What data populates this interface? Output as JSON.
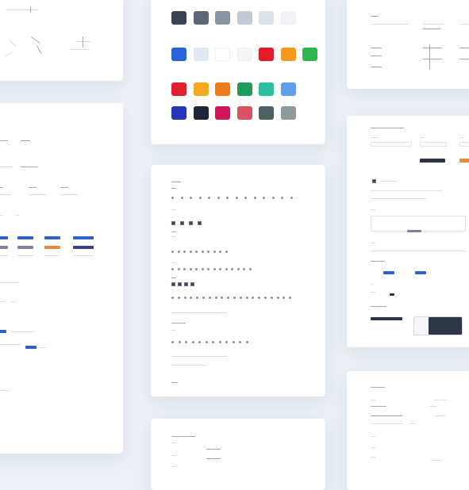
{
  "colors": {
    "background": "#edf1f7",
    "card": "#ffffff",
    "primary": "#2f62c7",
    "swatch_rows": [
      [
        "#3b4252",
        "#5d6677",
        "#8a93a4",
        "#c4cad5",
        "#dde1e8",
        "#f1f3f6"
      ],
      [
        "#2b63d9",
        "#dfe9f8",
        "#ffffff",
        "#f4f5f7",
        "#e21b2c",
        "#f39a1c",
        "#2fb550"
      ],
      [
        "#e0202e",
        "#f5a91f",
        "#ef7a1a",
        "#1f9c5c",
        "#2cbf9d",
        "#5fa0e8"
      ],
      [
        "#2636b8",
        "#1f2439",
        "#d4145a",
        "#d9525e",
        "#4c5f63",
        "#8d9b9e"
      ]
    ]
  },
  "icons": {
    "check_icon": "check-icon",
    "radio_icon": "radio-icon",
    "toggle_icon": "toggle-icon",
    "bullet_icon": "bullet-icon"
  }
}
